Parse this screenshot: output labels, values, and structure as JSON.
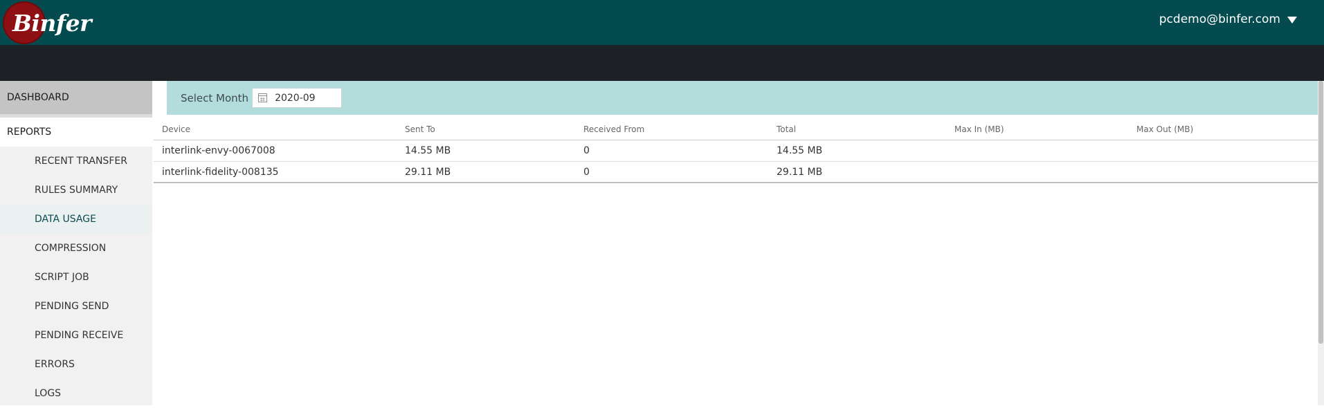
{
  "header": {
    "logo_text": "Binfer",
    "user_email": "pcdemo@binfer.com"
  },
  "sidebar": {
    "dashboard": "DASHBOARD",
    "reports": "REPORTS",
    "items": [
      {
        "label": "RECENT TRANSFER"
      },
      {
        "label": "RULES SUMMARY"
      },
      {
        "label": "DATA USAGE"
      },
      {
        "label": "COMPRESSION"
      },
      {
        "label": "SCRIPT JOB"
      },
      {
        "label": "PENDING SEND"
      },
      {
        "label": "PENDING RECEIVE"
      },
      {
        "label": "ERRORS"
      },
      {
        "label": "LOGS"
      }
    ],
    "active_item": "DATA USAGE"
  },
  "filter": {
    "label": "Select Month",
    "month_value": "2020-09"
  },
  "table": {
    "columns": [
      "Device",
      "Sent To",
      "Received From",
      "Total",
      "Max In (MB)",
      "Max Out (MB)"
    ],
    "rows": [
      [
        "interlink-envy-0067008",
        "14.55 MB",
        "0",
        "14.55 MB",
        "",
        ""
      ],
      [
        "interlink-fidelity-008135",
        "29.11 MB",
        "0",
        "29.11 MB",
        "",
        ""
      ]
    ]
  },
  "colors": {
    "topbar": "#034b4f",
    "darkbar": "#1d2024",
    "filter_bar": "#b3dcdc",
    "logo_red": "#8e1014"
  }
}
